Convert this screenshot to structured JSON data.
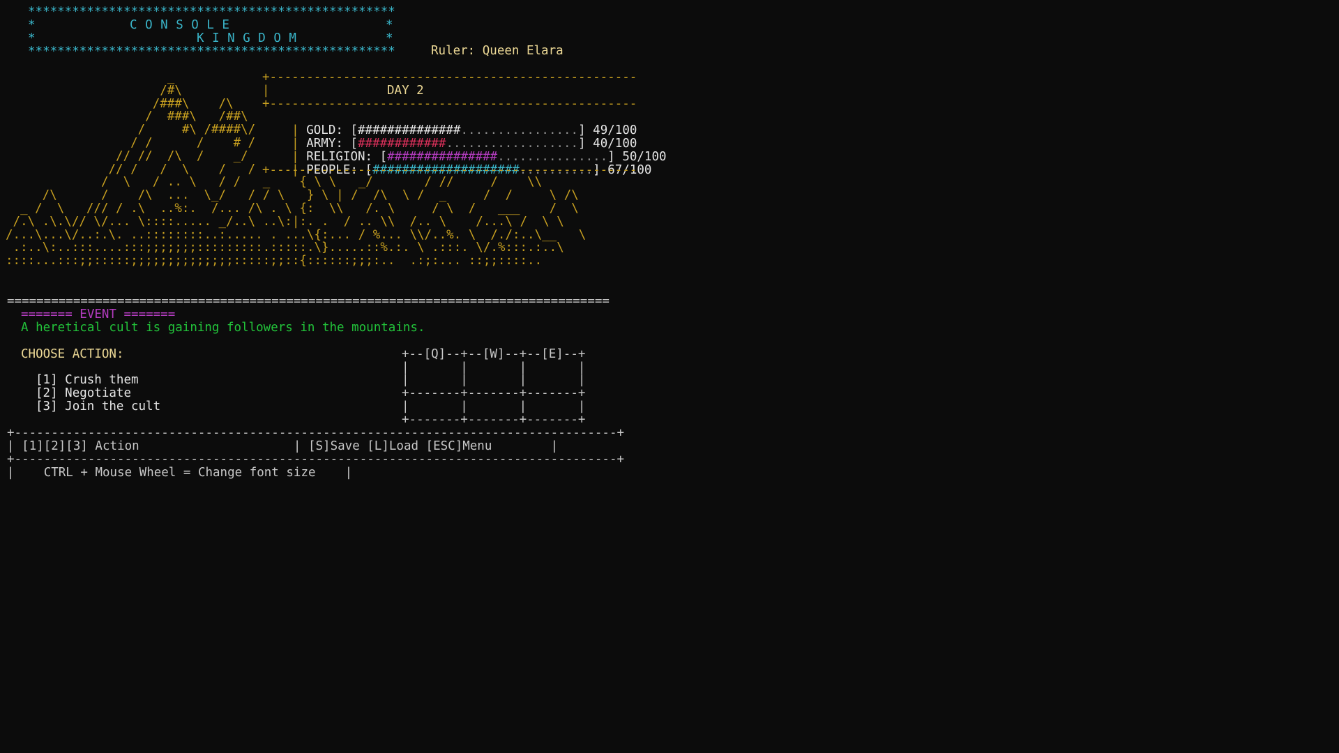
{
  "header": {
    "border_top": "**************************************************",
    "border_bottom": "**************************************************",
    "title_line1_left": "*",
    "title_word1": "C O N S O L E",
    "title_line1_right": "*",
    "title_line2_left": "*",
    "title_word2": "K I N G D O M",
    "title_line2_right": "*",
    "ruler_label": "Ruler:",
    "ruler_name": "Queen Elara"
  },
  "art": {
    "lines": [
      "                      _",
      "                     /#\\",
      "                    /###\\    /\\",
      "                   /  ###\\   /##\\",
      "                  /     #\\ /####\\/",
      "                 / /      /    # /",
      "               // //  /\\  /    _/",
      "              // /   /  \\    /   /",
      "             /  \\   / .. \\   / /   _    { \\ \\   _/       / //     /    \\\\",
      "     /\\      /    /\\  ...  \\_/   / / \\   } \\ | /  /\\  \\ /  _     /  /     \\ /\\",
      "  _ /  \\   /// / .\\  ..%:.  /... /\\ . \\ {:  \\\\   /. \\     / \\  /   ___    /  \\",
      " /.\\ .\\.\\// \\/... \\::::..... _/..\\ ..\\:|:. .  / .. \\\\  /.. \\    /...\\ /  \\ \\",
      "/...\\...\\/..:.\\. ..::::::::..:..... . ...\\{:... / %... \\\\/..%. \\  /./:..\\__   \\",
      " .:..\\:..:::....:::;;;;;;;:::::::::.:::::.\\}.....::%.:. \\ .:::. \\/.%:::.:..\\",
      "::::...:::;;:::::;;;;;;;;;;;;;;:::::;;::{::::::;;;:..  .:;:... ::;;::::.."
    ]
  },
  "stats": {
    "frame_top": "+--------------------------------------------------",
    "frame_mid": "+--------------------------------------------------",
    "frame_bottom": "+--------------------------------------------------",
    "day_label": "DAY 2",
    "rows": [
      {
        "label": "GOLD:",
        "filled": "##############",
        "empty": "................",
        "value": "49/100",
        "color": "#e6e6e6"
      },
      {
        "label": "ARMY:",
        "filled": "############",
        "empty": "..................",
        "value": "40/100",
        "color": "#d8305a"
      },
      {
        "label": "RELIGION:",
        "filled": "###############",
        "empty": "...............",
        "value": "50/100",
        "color": "#b43cc0"
      },
      {
        "label": "PEOPLE:",
        "filled": "####################",
        "empty": "..........",
        "value": "67/100",
        "color": "#3ab5c9"
      }
    ]
  },
  "divider": "==================================================================================",
  "event": {
    "header": "======= EVENT =======",
    "text": "A heretical cult is gaining followers in the mountains."
  },
  "actions": {
    "title": "CHOOSE ACTION:",
    "items": [
      {
        "key": "[1]",
        "label": "Crush them"
      },
      {
        "key": "[2]",
        "label": "Negotiate"
      },
      {
        "key": "[3]",
        "label": "Join the cult"
      }
    ]
  },
  "grid": {
    "line1": "+--[Q]--+--[W]--+--[E]--+",
    "line2": "|       |       |       |",
    "line3": "|       |       |       |",
    "line4": "+-------+-------+-------+",
    "line5": "|       |       |       |",
    "line6": "+-------+-------+-------+"
  },
  "footer": {
    "border": "+----------------------------------------------------------------------------------+",
    "left_text": "[1][2][3] Action",
    "right_text": "[S]Save [L]Load [ESC]Menu",
    "hint_text": "CTRL + Mouse Wheel = Change font size"
  }
}
